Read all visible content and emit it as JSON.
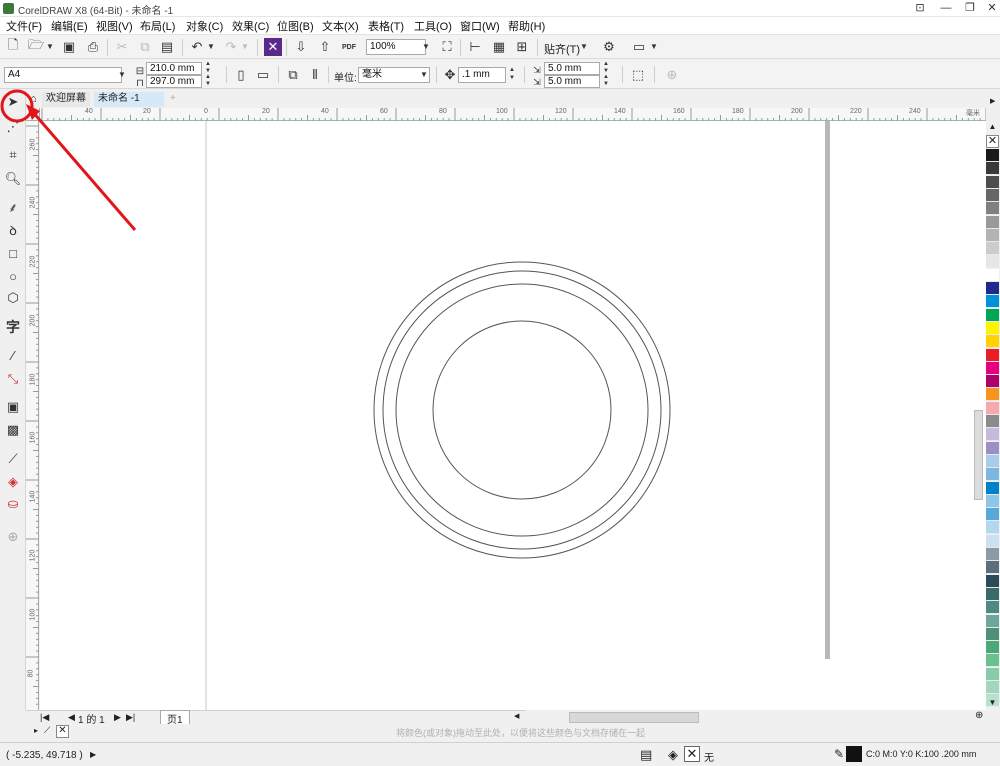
{
  "app": {
    "title": "CorelDRAW X8 (64-Bit) - 未命名 -1"
  },
  "menu": [
    "文件(F)",
    "编辑(E)",
    "视图(V)",
    "布局(L)",
    "对象(C)",
    "效果(C)",
    "位图(B)",
    "文本(X)",
    "表格(T)",
    "工具(O)",
    "窗口(W)",
    "帮助(H)"
  ],
  "toolbar": {
    "zoom": "100%",
    "snap_label": "贴齐(T)",
    "pdf_label": "PDF"
  },
  "properties": {
    "page_size": "A4",
    "width": "210.0 mm",
    "height": "297.0 mm",
    "units_label": "单位:",
    "units_value": "毫米",
    "nudge": ".1 mm",
    "dup_x": "5.0 mm",
    "dup_y": "5.0 mm"
  },
  "tabs": {
    "welcome": "欢迎屏幕",
    "document": "未命名 -1"
  },
  "ruler": {
    "h_labels": [
      "40",
      "20",
      "0",
      "20",
      "40",
      "60",
      "80",
      "100",
      "120",
      "140",
      "160",
      "180",
      "200",
      "220",
      "240"
    ],
    "h_units": "毫米",
    "v_labels": [
      "260",
      "240",
      "220",
      "200",
      "180",
      "160",
      "140",
      "120",
      "100",
      "80"
    ]
  },
  "pagenav": {
    "page_of": "1 的 1",
    "page_tab": "页1"
  },
  "status": {
    "coords": "( -5.235, 49.718 )",
    "hint": "将颜色(或对象)拖动至此处，以便将这些颜色与文档存储在一起",
    "fill_label": "无",
    "outline_info": "C:0 M:0 Y:0 K:100 .200 mm"
  },
  "colors": {
    "annotation": "#e0161b",
    "ruler_border": "#99bbbb",
    "page_shadow": "#b8b8b8",
    "circle_stroke": "#555555",
    "palette": [
      "#1a1a1a",
      "#3a3a3a",
      "#4d4d4d",
      "#666666",
      "#808080",
      "#999999",
      "#b3b3b3",
      "#cccccc",
      "#e6e6e6",
      "#ffffff",
      "#1f2a8c",
      "#0093dd",
      "#00a651",
      "#fff200",
      "#ffd200",
      "#ed1c24",
      "#e4007f",
      "#b0006a",
      "#f7941d",
      "#f9a8ae",
      "#8b8b8b",
      "#c7b8dd",
      "#9c8fc5",
      "#a7cde9",
      "#7ab8e0",
      "#0082c8",
      "#8fc6e8",
      "#55a8d8",
      "#b3d7ee",
      "#cce1ef",
      "#8c9aa8",
      "#5a6e7e",
      "#2c4a5a",
      "#3a6a6a",
      "#4f8a82",
      "#6ba79a",
      "#4e9078",
      "#4ba878",
      "#6ac08e",
      "#86cca8",
      "#a2d6bf",
      "#b6e1cf"
    ]
  },
  "icons": {
    "select_tool": "pointer-arrow-icon",
    "shape_tool": "shape-icon",
    "crop_tool": "crop-icon",
    "zoom_tool": "magnifier-icon",
    "freehand_tool": "freehand-icon",
    "artistic_tool": "pen-icon",
    "rect_tool": "rectangle-icon",
    "ellipse_tool": "ellipse-icon",
    "polygon_tool": "polygon-icon",
    "text_tool": "text-icon",
    "line_tool": "parallel-dimension-icon",
    "connector_tool": "connector-icon",
    "dropshadow_tool": "drop-shadow-icon",
    "transparency_tool": "transparency-icon",
    "eyedropper_tool": "eyedropper-icon",
    "fill_tool": "interactive-fill-icon",
    "smartfill_tool": "smart-fill-icon",
    "add_tool": "plus-circle-icon"
  }
}
